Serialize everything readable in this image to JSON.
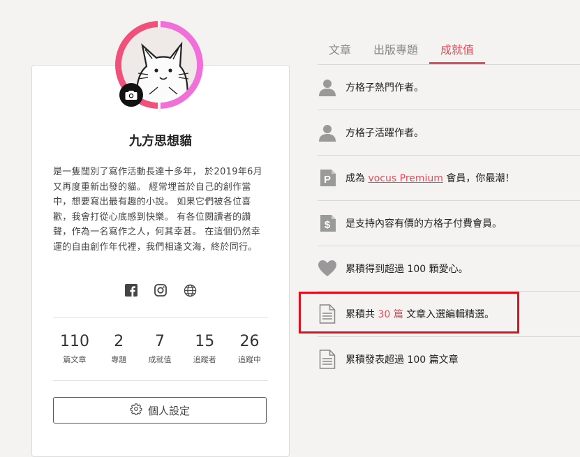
{
  "profile": {
    "name": "九方思想貓",
    "bio": "是一隻闊別了寫作活動長達十多年， 於2019年6月又再度重新出發的貓。 經常埋首於自己的創作當中，想要寫出最有趣的小說。 如果它們被各位喜歡，我會打從心底感到快樂。 有各位閱讀者的讚聲，作為一名寫作之人，何其幸甚。 在這個仍然幸運的自由創作年代裡，我們相逢文海，終於同行。",
    "social_icons": [
      "facebook-icon",
      "instagram-icon",
      "globe-icon"
    ],
    "stats": [
      {
        "num": "110",
        "label": "篇文章"
      },
      {
        "num": "2",
        "label": "專題"
      },
      {
        "num": "7",
        "label": "成就值"
      },
      {
        "num": "15",
        "label": "追蹤者"
      },
      {
        "num": "26",
        "label": "追蹤中"
      }
    ],
    "settings_label": "個人設定"
  },
  "tabs": [
    {
      "label": "文章"
    },
    {
      "label": "出版專題"
    },
    {
      "label": "成就值"
    }
  ],
  "achievements": {
    "a1": "方格子熱門作者。",
    "a2": "方格子活躍作者。",
    "a3_pre": "成為 ",
    "a3_link": "vocus Premium",
    "a3_post": " 會員，你最潮！",
    "a4": "是支持內容有價的方格子付費會員。",
    "a5": "累積得到超過 100 顆愛心。",
    "a6_pre": "累積共 ",
    "a6_count": "30 篇",
    "a6_post": " 文章入選編輯精選。",
    "a7": "累積發表超過 100 篇文章"
  },
  "colors": {
    "accent": "#e8495a",
    "highlight": "#e0101e",
    "background": "#f5f3f1"
  }
}
